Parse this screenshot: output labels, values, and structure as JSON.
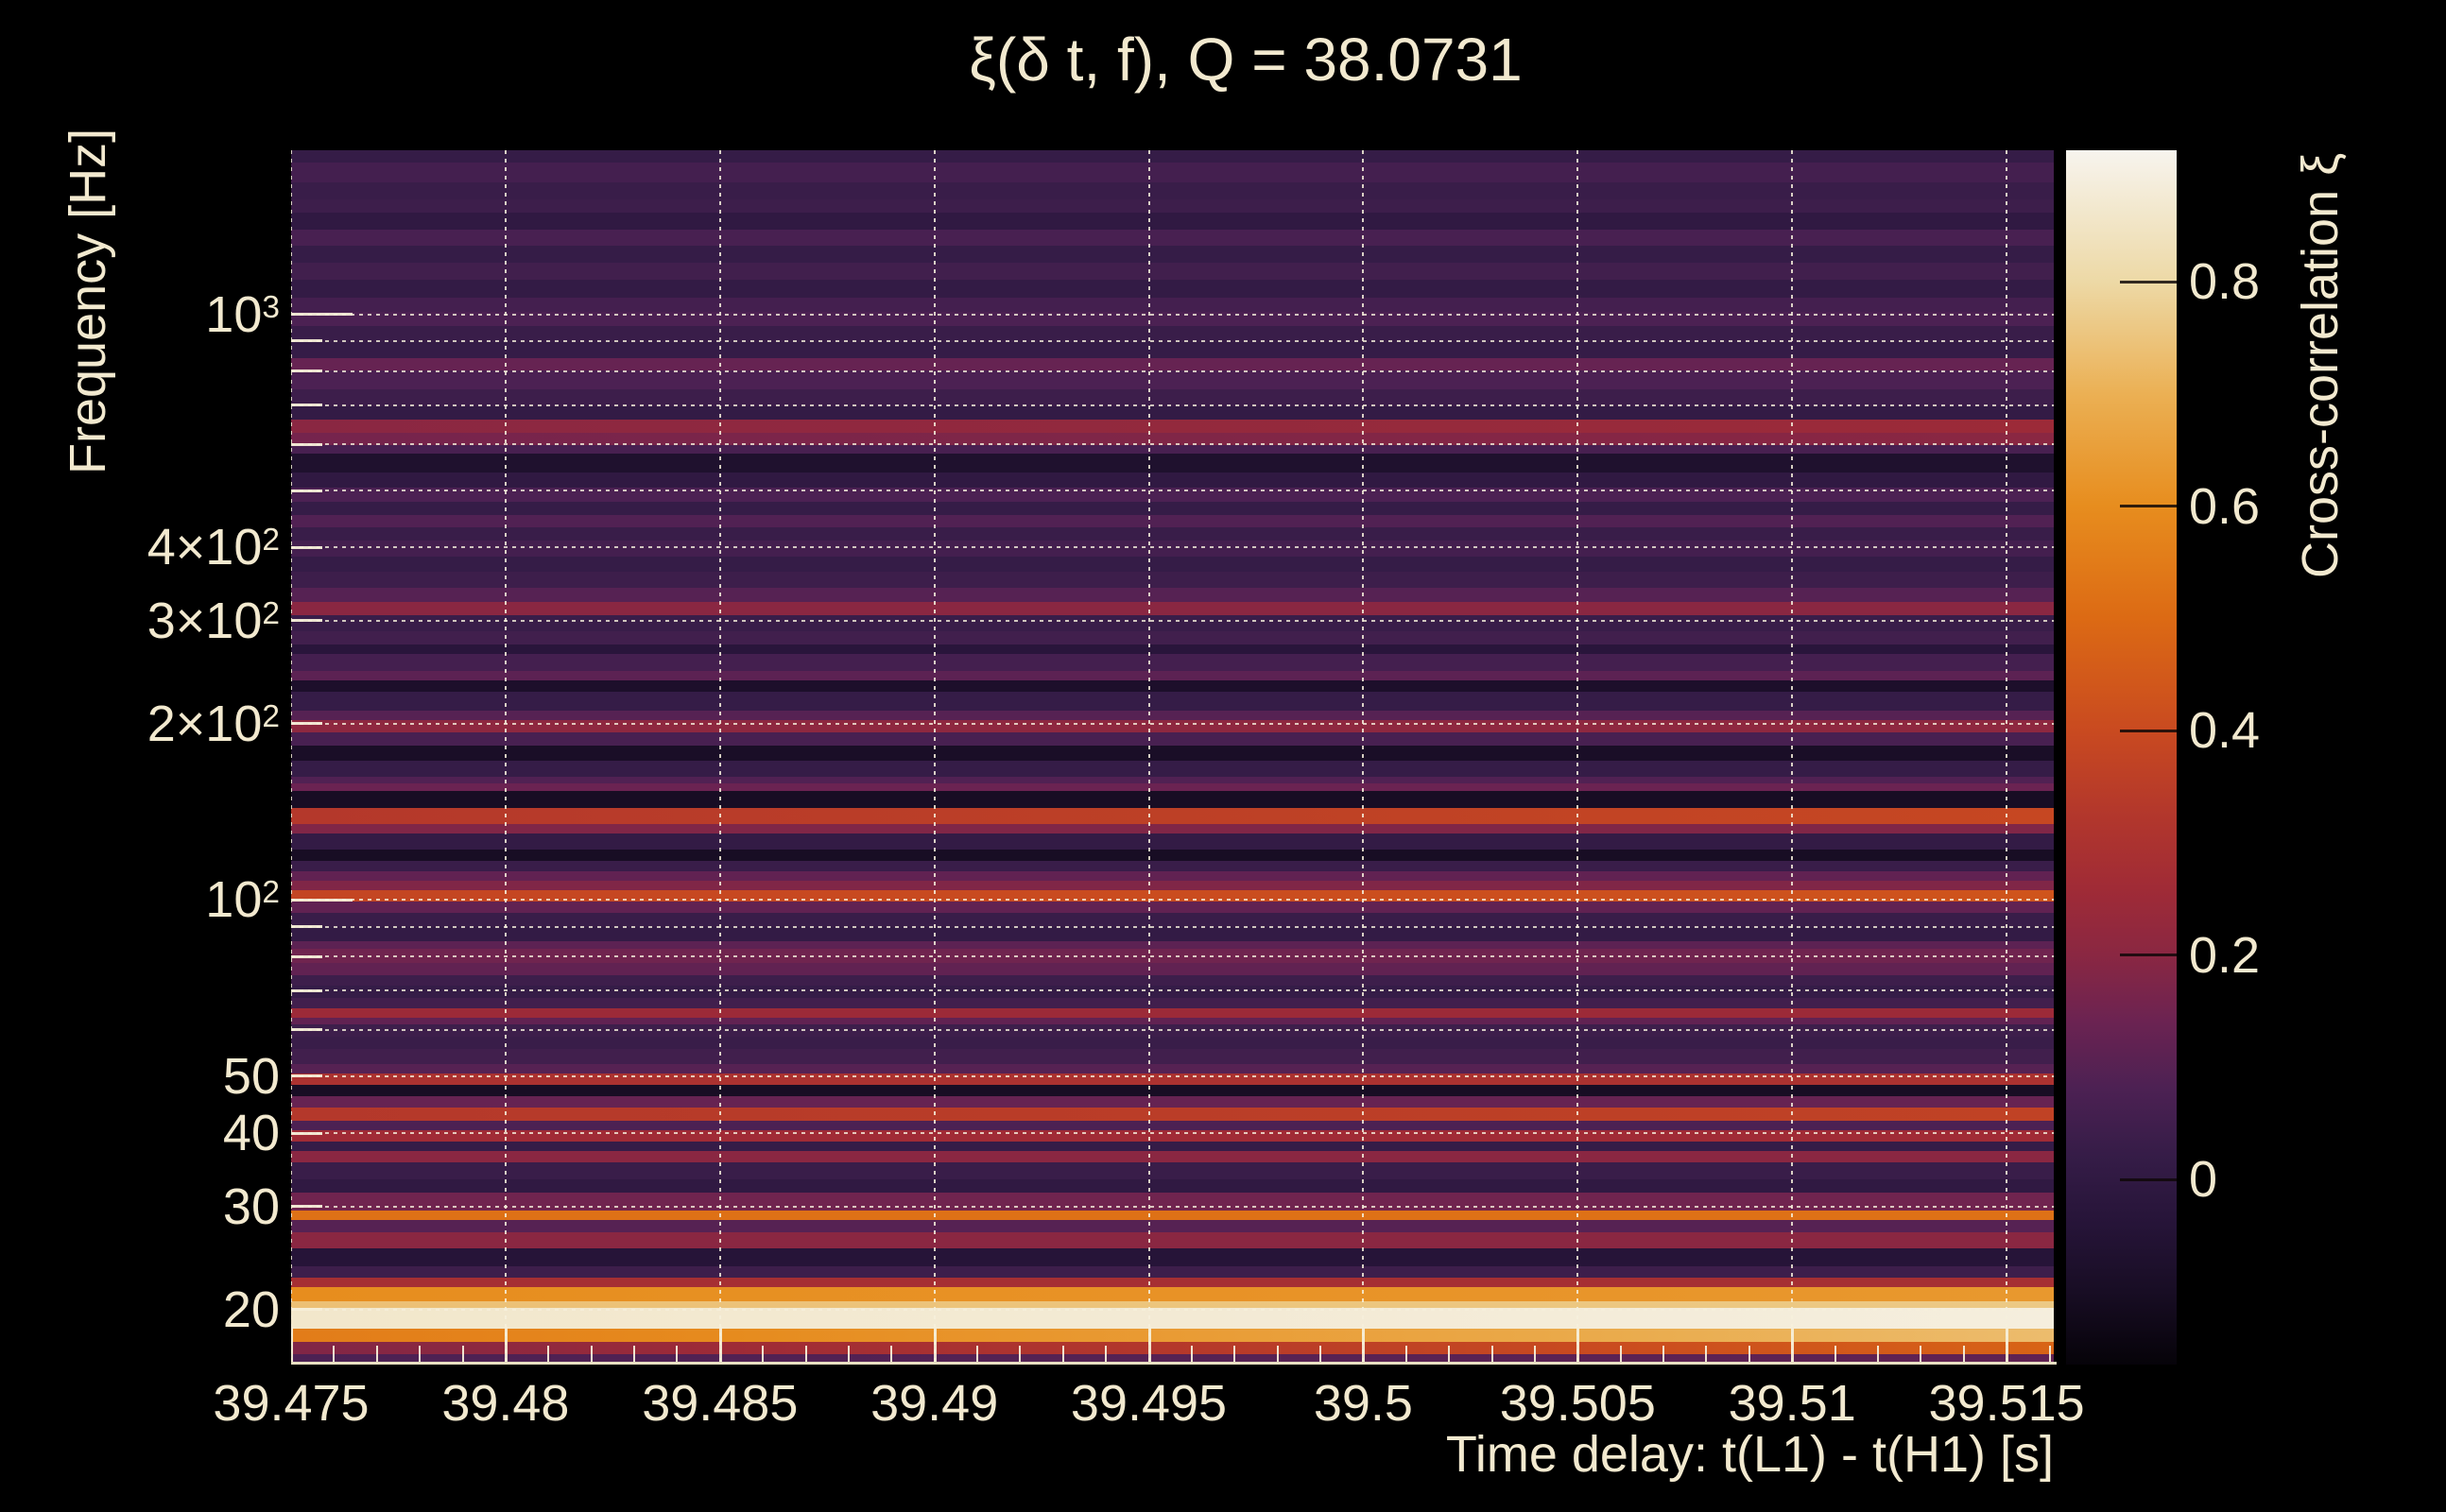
{
  "figure": {
    "background": "#000000",
    "text_color": "#f2e9cf"
  },
  "chart_data": {
    "type": "heatmap",
    "title": "ξ(δ t, f), Q = 38.0731",
    "xlabel": "Time delay: t(L1) - t(H1) [s]",
    "ylabel": "Frequency [Hz]",
    "colorbar_label": "Cross-correlation ξ",
    "x_range": [
      39.475,
      39.5161
    ],
    "x_major_ticks": [
      {
        "value": 39.475,
        "label": "39.475"
      },
      {
        "value": 39.48,
        "label": "39.48"
      },
      {
        "value": 39.485,
        "label": "39.485"
      },
      {
        "value": 39.49,
        "label": "39.49"
      },
      {
        "value": 39.495,
        "label": "39.495"
      },
      {
        "value": 39.5,
        "label": "39.5"
      },
      {
        "value": 39.505,
        "label": "39.505"
      },
      {
        "value": 39.51,
        "label": "39.51"
      },
      {
        "value": 39.515,
        "label": "39.515"
      }
    ],
    "x_minor_step": 0.001,
    "y_scale": "log",
    "y_range_hz": [
      16.1,
      1905
    ],
    "y_tick_labels": [
      {
        "f": 1000,
        "base": "10",
        "exp": "3",
        "major": true
      },
      {
        "f": 400,
        "base": "4×10",
        "exp": "2"
      },
      {
        "f": 300,
        "base": "3×10",
        "exp": "2"
      },
      {
        "f": 200,
        "base": "2×10",
        "exp": "2"
      },
      {
        "f": 100,
        "base": "10",
        "exp": "2",
        "major": true
      },
      {
        "f": 50,
        "base": "50"
      },
      {
        "f": 40,
        "base": "40"
      },
      {
        "f": 30,
        "base": "30"
      },
      {
        "f": 20,
        "base": "20"
      }
    ],
    "y_gridlines_hz": [
      1000,
      900,
      800,
      700,
      600,
      500,
      400,
      300,
      200,
      100,
      90,
      80,
      70,
      60,
      50,
      40,
      30,
      20
    ],
    "colorbar": {
      "vmin": -0.165,
      "vmax": 0.917,
      "ticks": [
        {
          "value": 0,
          "label": "0"
        },
        {
          "value": 0.2,
          "label": "0.2"
        },
        {
          "value": 0.4,
          "label": "0.4"
        },
        {
          "value": 0.6,
          "label": "0.6"
        },
        {
          "value": 0.8,
          "label": "0.8"
        }
      ]
    },
    "colormap_stops": [
      [
        -0.165,
        "#060309"
      ],
      [
        -0.1,
        "#180d24"
      ],
      [
        -0.04,
        "#261438"
      ],
      [
        0.02,
        "#351c47"
      ],
      [
        0.08,
        "#4c2153"
      ],
      [
        0.14,
        "#6b2352"
      ],
      [
        0.2,
        "#8a2742"
      ],
      [
        0.26,
        "#a02b36"
      ],
      [
        0.33,
        "#b4382b"
      ],
      [
        0.4,
        "#c94a20"
      ],
      [
        0.5,
        "#dc6a14"
      ],
      [
        0.6,
        "#e78d1e"
      ],
      [
        0.7,
        "#ebb054"
      ],
      [
        0.8,
        "#edd9a6"
      ],
      [
        0.917,
        "#f7f4ee"
      ]
    ],
    "band_axis_note": "bands listed top-to-bottom as [end_fraction_of_log_frequency_span, xi_value, optional_left_to_right_xi_gradient]",
    "bands": [
      [
        0.0101,
        0.02
      ],
      [
        0.0265,
        0.06
      ],
      [
        0.0405,
        0.03
      ],
      [
        0.0514,
        0.04
      ],
      [
        0.0654,
        0.0
      ],
      [
        0.0786,
        0.07
      ],
      [
        0.0926,
        0.02
      ],
      [
        0.1066,
        0.05
      ],
      [
        0.1214,
        0.01
      ],
      [
        0.1331,
        0.06
      ],
      [
        0.1447,
        0.08
      ],
      [
        0.158,
        0.03
      ],
      [
        0.1712,
        0.02
      ],
      [
        0.1813,
        0.13
      ],
      [
        0.1969,
        0.08
      ],
      [
        0.2109,
        0.04
      ],
      [
        0.2218,
        0.01
      ],
      [
        0.2327,
        0.2,
        0.05
      ],
      [
        0.2428,
        0.16,
        0.04
      ],
      [
        0.2498,
        0.07
      ],
      [
        0.2654,
        -0.07
      ],
      [
        0.2778,
        0.0
      ],
      [
        0.2895,
        0.08
      ],
      [
        0.3004,
        0.02
      ],
      [
        0.3105,
        0.09
      ],
      [
        0.3214,
        0.03
      ],
      [
        0.3346,
        0.06
      ],
      [
        0.3471,
        0.02
      ],
      [
        0.3603,
        0.04
      ],
      [
        0.372,
        0.1
      ],
      [
        0.3829,
        0.2
      ],
      [
        0.3961,
        0.03
      ],
      [
        0.407,
        0.05
      ],
      [
        0.4148,
        -0.03
      ],
      [
        0.4288,
        0.06
      ],
      [
        0.4366,
        0.11
      ],
      [
        0.4459,
        -0.08
      ],
      [
        0.4615,
        0.02
      ],
      [
        0.4693,
        0.1
      ],
      [
        0.4794,
        0.21
      ],
      [
        0.4903,
        0.07
      ],
      [
        0.5027,
        -0.09
      ],
      [
        0.516,
        0.02
      ],
      [
        0.5214,
        0.09
      ],
      [
        0.5276,
        0.14
      ],
      [
        0.5416,
        -0.1
      ],
      [
        0.5549,
        0.33,
        0.06
      ],
      [
        0.5626,
        0.18
      ],
      [
        0.5759,
        0.01
      ],
      [
        0.5852,
        -0.1
      ],
      [
        0.5938,
        0.03
      ],
      [
        0.6016,
        0.12
      ],
      [
        0.6093,
        0.18
      ],
      [
        0.6187,
        0.38,
        0.05
      ],
      [
        0.628,
        0.12
      ],
      [
        0.6397,
        0.03
      ],
      [
        0.6514,
        0.01
      ],
      [
        0.6576,
        0.11
      ],
      [
        0.6693,
        0.15
      ],
      [
        0.6794,
        0.12
      ],
      [
        0.6879,
        0.04
      ],
      [
        0.6981,
        0.02
      ],
      [
        0.7066,
        0.05
      ],
      [
        0.7144,
        0.25
      ],
      [
        0.7198,
        0.12
      ],
      [
        0.73,
        0.04
      ],
      [
        0.7401,
        0.03
      ],
      [
        0.7525,
        0.05
      ],
      [
        0.7603,
        0.1
      ],
      [
        0.7696,
        0.3
      ],
      [
        0.779,
        -0.1
      ],
      [
        0.7883,
        0.13
      ],
      [
        0.7992,
        0.33,
        0.04
      ],
      [
        0.807,
        0.08
      ],
      [
        0.8163,
        0.26
      ],
      [
        0.8241,
        0.02
      ],
      [
        0.8334,
        0.2
      ],
      [
        0.8474,
        0.03
      ],
      [
        0.8583,
        0.0
      ],
      [
        0.8731,
        0.15
      ],
      [
        0.8809,
        0.52
      ],
      [
        0.891,
        0.1
      ],
      [
        0.9043,
        0.2
      ],
      [
        0.9191,
        -0.04
      ],
      [
        0.9284,
        0.04
      ],
      [
        0.9362,
        0.28
      ],
      [
        0.9479,
        0.6,
        0.03
      ],
      [
        0.9533,
        0.74,
        0.02
      ],
      [
        0.9704,
        0.86,
        0.03
      ],
      [
        0.9813,
        0.55,
        0.18
      ],
      [
        0.9914,
        0.18,
        0.3
      ],
      [
        1.0,
        0.08,
        0.04
      ]
    ]
  }
}
